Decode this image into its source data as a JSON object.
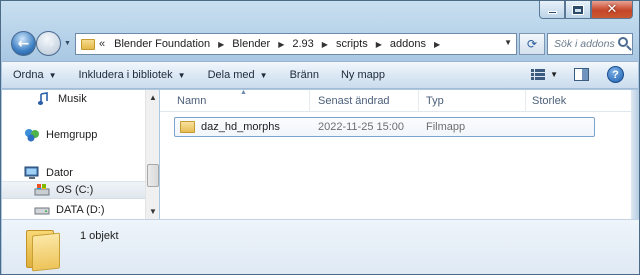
{
  "window": {
    "caption": {
      "minimize": "minimize",
      "maximize": "maximize",
      "close": "close"
    }
  },
  "nav": {
    "breadcrumb_lead": "«",
    "breadcrumbs": [
      "Blender Foundation",
      "Blender",
      "2.93",
      "scripts",
      "addons"
    ],
    "search_placeholder": "Sök i addons"
  },
  "toolbar": {
    "organize": "Ordna",
    "include": "Inkludera i bibliotek",
    "share": "Dela med",
    "burn": "Bränn",
    "new_folder": "Ny mapp",
    "help": "?"
  },
  "sidebar": {
    "items": [
      {
        "label": "Musik",
        "icon": "music-icon"
      },
      {
        "label": "Hemgrupp",
        "icon": "homegroup-icon"
      },
      {
        "label": "Dator",
        "icon": "computer-icon"
      },
      {
        "label": "OS (C:)",
        "icon": "drive-icon",
        "selected": true
      },
      {
        "label": "DATA (D:)",
        "icon": "drive-icon"
      }
    ]
  },
  "columns": {
    "name": "Namn",
    "modified": "Senast ändrad",
    "type": "Typ",
    "size": "Storlek"
  },
  "files": [
    {
      "name": "daz_hd_morphs",
      "modified": "2022-11-25 15:00",
      "type": "Filmapp",
      "size": ""
    }
  ],
  "details": {
    "count": "1 objekt"
  },
  "colors": {
    "accent": "#3c7fc3",
    "selection_border": "#7da2ce",
    "chrome": "#b9d4ea"
  }
}
